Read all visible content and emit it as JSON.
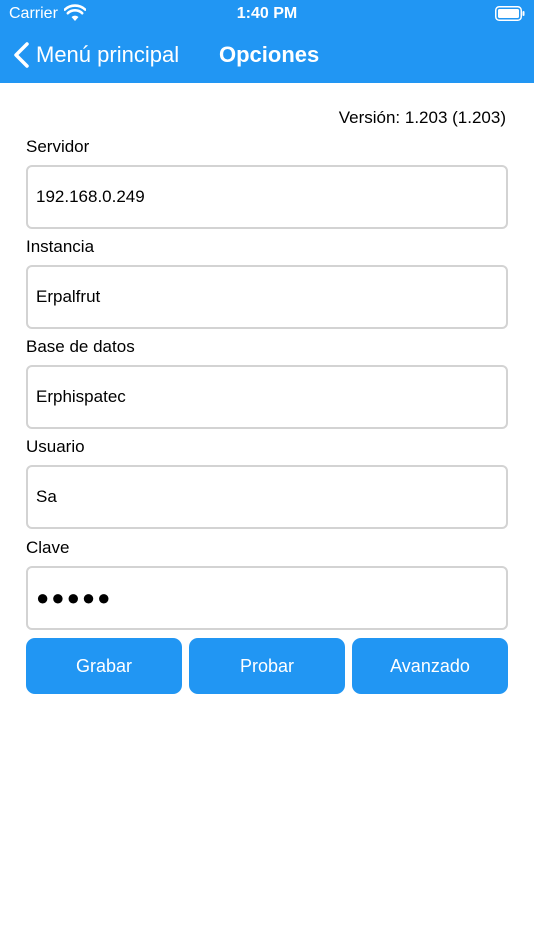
{
  "status_bar": {
    "carrier": "Carrier",
    "time": "1:40 PM"
  },
  "nav": {
    "back_label": "Menú principal",
    "title": "Opciones"
  },
  "version": "Versión: 1.203 (1.203)",
  "fields": {
    "servidor": {
      "label": "Servidor",
      "value": "192.168.0.249"
    },
    "instancia": {
      "label": "Instancia",
      "value": "Erpalfrut"
    },
    "base_datos": {
      "label": "Base de datos",
      "value": "Erphispatec"
    },
    "usuario": {
      "label": "Usuario",
      "value": "Sa"
    },
    "clave": {
      "label": "Clave",
      "value": "●●●●●"
    }
  },
  "buttons": {
    "grabar": "Grabar",
    "probar": "Probar",
    "avanzado": "Avanzado"
  },
  "colors": {
    "accent": "#2196F3",
    "input_border": "#d3d3d3"
  },
  "icons": {
    "wifi": "wifi-icon",
    "battery": "battery-icon",
    "back": "chevron-left-icon"
  }
}
